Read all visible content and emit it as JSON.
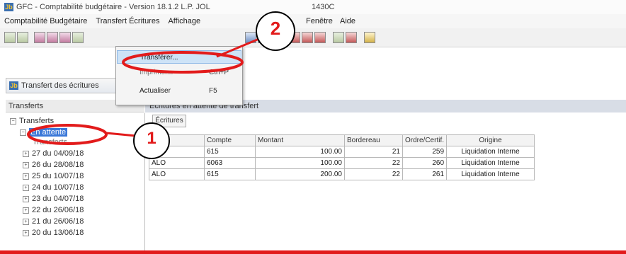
{
  "window": {
    "title": "GFC - Comptabilité budgétaire - Version 18.1.2  L.P. JOL",
    "title_suffix": "1430C"
  },
  "menubar": {
    "items": [
      "Comptabilité Budgétaire",
      "Transfert Écritures",
      "Affichage",
      "Fenêtre",
      "Aide"
    ]
  },
  "dropdown": {
    "items": [
      {
        "label": "Transférer...",
        "shortcut": ""
      },
      {
        "label": "Imprimer...",
        "shortcut": "Ctrl+P"
      },
      {
        "label": "Actualiser",
        "shortcut": "F5"
      }
    ]
  },
  "subwindow": {
    "title": "Transfert des écritures"
  },
  "left_panel": {
    "header": "Transferts",
    "root": "Transferts",
    "selected": "En attente",
    "partial_label": "Transferts",
    "nodes": [
      "27 du 04/09/18",
      "26 du 28/08/18",
      "25 du 10/07/18",
      "24 du 10/07/18",
      "23 du 04/07/18",
      "22 du 26/06/18",
      "21 du 26/06/18",
      "20 du 13/06/18"
    ]
  },
  "right_panel": {
    "header": "Écritures en attente de transfert",
    "tab": "Écritures"
  },
  "table": {
    "headers": [
      "ce",
      "Compte",
      "Montant",
      "Bordereau",
      "Ordre/Certif.",
      "Origine"
    ],
    "rows": [
      [
        "",
        "615",
        "100.00",
        "21",
        "259",
        "Liquidation Interne"
      ],
      [
        "ALO",
        "6063",
        "100.00",
        "22",
        "260",
        "Liquidation Interne"
      ],
      [
        "ALO",
        "615",
        "200.00",
        "22",
        "261",
        "Liquidation Interne"
      ]
    ]
  },
  "annotations": {
    "callout1": "1",
    "callout2": "2",
    "accent_color": "#e21b1b"
  }
}
